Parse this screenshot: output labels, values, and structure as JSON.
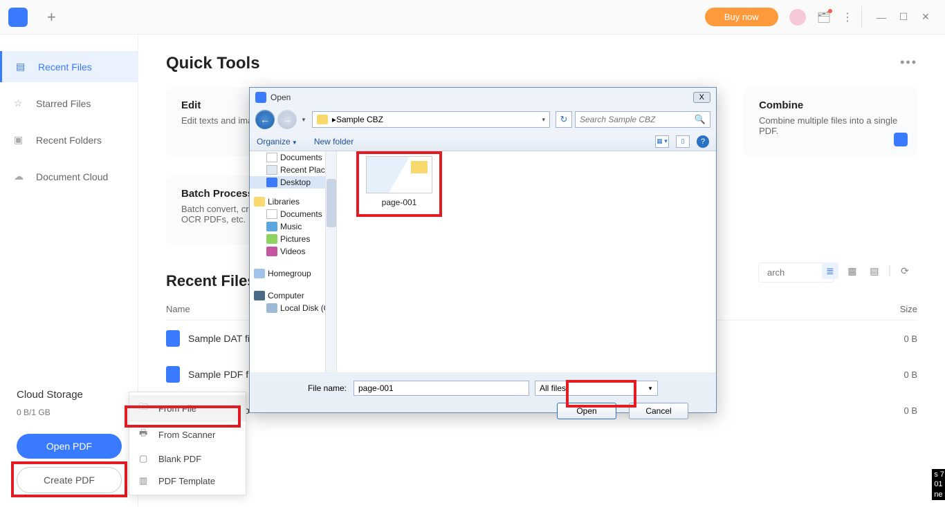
{
  "topbar": {
    "buy_now": "Buy now"
  },
  "sidebar": {
    "items": [
      {
        "label": "Recent Files"
      },
      {
        "label": "Starred Files"
      },
      {
        "label": "Recent Folders"
      },
      {
        "label": "Document Cloud"
      }
    ],
    "cloud_title": "Cloud Storage",
    "cloud_sub": "0 B/1 GB",
    "open_pdf": "Open PDF",
    "create_pdf": "Create PDF"
  },
  "ctx_menu": {
    "from_file": "From File",
    "from_scanner": "From Scanner",
    "blank_pdf": "Blank PDF",
    "pdf_template": "PDF Template"
  },
  "main": {
    "quick_tools": "Quick Tools",
    "edit_title": "Edit",
    "edit_desc": "Edit texts and image",
    "batch_title": "Batch Process",
    "batch_desc": "Batch convert, creat\nOCR PDFs, etc.",
    "combine_title": "Combine",
    "combine_desc": "Combine multiple files into a single PDF.",
    "recent_title": "Recent Files",
    "name_col": "Name",
    "size_col": "Size",
    "search_placeholder": "arch",
    "rows": [
      {
        "name": "Sample DAT fi",
        "size": "0 B"
      },
      {
        "name": "Sample PDF fi",
        "size": "0 B"
      },
      {
        "name": "SampleData.p",
        "size": "0 B"
      }
    ]
  },
  "dialog": {
    "title": "Open",
    "breadcrumb": "Sample CBZ",
    "search_placeholder": "Search Sample CBZ",
    "organize": "Organize",
    "new_folder": "New folder",
    "tree": {
      "documents": "Documents",
      "recent_places": "Recent Places",
      "desktop": "Desktop",
      "libraries": "Libraries",
      "music": "Music",
      "pictures": "Pictures",
      "videos": "Videos",
      "homegroup": "Homegroup",
      "computer": "Computer",
      "local_disk": "Local Disk (C:"
    },
    "file_label": "page-001",
    "file_name_label": "File name:",
    "file_name_value": "page-001",
    "filter": "All files",
    "open_btn": "Open",
    "cancel_btn": "Cancel",
    "close_x": "X"
  },
  "corner": "s 7\n01\nne"
}
